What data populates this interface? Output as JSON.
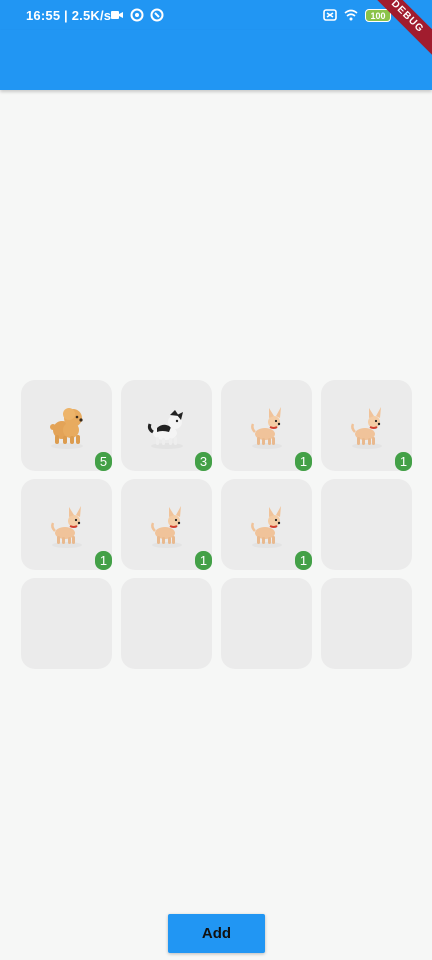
{
  "status_bar": {
    "time_speed": "16:55 | 2.5K/s",
    "battery": "100",
    "icons": [
      "video-camera-icon",
      "sync-icon",
      "sync-alt-icon",
      "mute-icon",
      "wifi-icon",
      "battery-icon",
      "charging-icon"
    ]
  },
  "debug_banner": "DEBUG",
  "colors": {
    "primary": "#2196f3",
    "badge": "#43a047",
    "cell": "#ebebeb",
    "background": "#f6f7f6"
  },
  "slots": [
    {
      "pet": "poodle",
      "count": "5"
    },
    {
      "pet": "border-collie",
      "count": "3"
    },
    {
      "pet": "chihuahua",
      "count": "1"
    },
    {
      "pet": "chihuahua",
      "count": "1"
    },
    {
      "pet": "chihuahua",
      "count": "1"
    },
    {
      "pet": "chihuahua",
      "count": "1"
    },
    {
      "pet": "chihuahua",
      "count": "1"
    },
    {
      "pet": "",
      "count": ""
    },
    {
      "pet": "",
      "count": ""
    },
    {
      "pet": "",
      "count": ""
    },
    {
      "pet": "",
      "count": ""
    },
    {
      "pet": "",
      "count": ""
    }
  ],
  "add_button": {
    "label": "Add"
  }
}
